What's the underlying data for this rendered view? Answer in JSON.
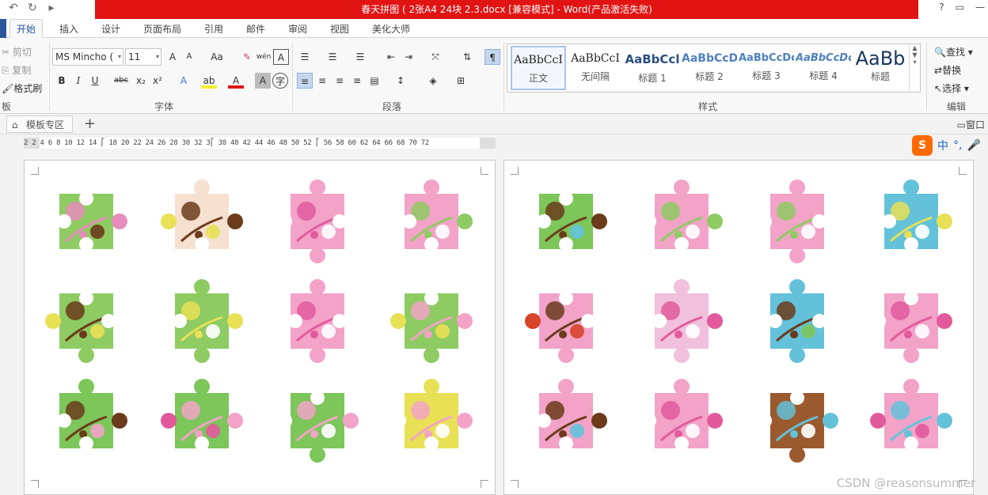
{
  "window": {
    "title": "春天拼图 ( 2张A4 24块 2.3.docx [兼容模式] - Word(产品激活失败)",
    "help": "?",
    "controls": [
      "?",
      "▭",
      "—"
    ]
  },
  "qat": [
    "↶",
    "↻",
    "▸"
  ],
  "tabs": [
    "开始",
    "插入",
    "设计",
    "页面布局",
    "引用",
    "邮件",
    "审阅",
    "视图",
    "美化大师"
  ],
  "active_tab": "开始",
  "clipboard": {
    "cut": "剪切",
    "copy": "复制",
    "format_painter": "格式刷",
    "group": "板"
  },
  "font": {
    "name": "MS Mincho (",
    "size": "11",
    "group": "字体",
    "bold": "B",
    "italic": "I",
    "underline": "U",
    "strike": "abc",
    "sub": "x₂",
    "sup": "x²",
    "grow": "A",
    "shrink": "A",
    "case": "Aa",
    "phonetic": "wén",
    "charborder": "A"
  },
  "paragraph": {
    "group": "段落"
  },
  "styles": {
    "group": "样式",
    "items": [
      {
        "preview": "AaBbCcI",
        "name": "正文"
      },
      {
        "preview": "AaBbCcI",
        "name": "无间隔"
      },
      {
        "preview": "AaBbCcl",
        "name": "标题 1"
      },
      {
        "preview": "AaBbCcD",
        "name": "标题 2"
      },
      {
        "preview": "AaBbCcDc",
        "name": "标题 3"
      },
      {
        "preview": "AaBbCcDc",
        "name": "标题 4"
      },
      {
        "preview": "AaBb",
        "name": "标题"
      }
    ]
  },
  "editing": {
    "find": "查找",
    "replace": "替换",
    "select": "选择",
    "group": "编辑"
  },
  "doctabs": {
    "tab": "模板专区",
    "add": "+",
    "right": "窗口"
  },
  "ruler": {
    "ticks": "2    2  4  6  8 10 12 14 ⎡ 18 20 22 24 26 28 30 32 3⎡ 38 40 42 44 46 48 50 52 ⎡ 56 58 60 62 64 66 68 70 72"
  },
  "ime": {
    "logo": "S",
    "lang": "中"
  },
  "watermark": "CSDN @reasonsummer",
  "colors": {
    "title_bar": "#e21313",
    "accent": "#2b579a",
    "pink": "#f2a3c7",
    "green": "#7cc65a",
    "yellow": "#e8e055",
    "brown": "#6b3b1b",
    "blue": "#63c2d9"
  },
  "pages": [
    {
      "name": "page-left",
      "pieces": [
        {
          "palette": [
            "#8ecb62",
            "#e68dbb",
            "#6b3b1b"
          ]
        },
        {
          "palette": [
            "#f6e0d0",
            "#6b3b1b",
            "#e8e055"
          ]
        },
        {
          "palette": [
            "#f2a3c7",
            "#e25a9c",
            "#ffffff"
          ]
        },
        {
          "palette": [
            "#f2a3c7",
            "#8ecb62",
            "#ffffff"
          ]
        },
        {
          "palette": [
            "#8ecb62",
            "#6b3b1b",
            "#e8e055"
          ]
        },
        {
          "palette": [
            "#8ecb62",
            "#e8e055",
            "#ffffff"
          ]
        },
        {
          "palette": [
            "#f2a3c7",
            "#e25a9c",
            "#ffffff"
          ]
        },
        {
          "palette": [
            "#8ecb62",
            "#f2a3c7",
            "#e8e055"
          ]
        },
        {
          "palette": [
            "#7cc65a",
            "#6b3b1b",
            "#f2a3c7"
          ]
        },
        {
          "palette": [
            "#7cc65a",
            "#f2a3c7",
            "#e25a9c"
          ]
        },
        {
          "palette": [
            "#7cc65a",
            "#f2a3c7",
            "#ffffff"
          ]
        },
        {
          "palette": [
            "#e8e055",
            "#f2a3c7",
            "#ffffff"
          ]
        }
      ]
    },
    {
      "name": "page-right",
      "pieces": [
        {
          "palette": [
            "#7cc65a",
            "#6b3b1b",
            "#63c2d9"
          ]
        },
        {
          "palette": [
            "#f2a3c7",
            "#8ecb62",
            "#ffffff"
          ]
        },
        {
          "palette": [
            "#f2a3c7",
            "#8ecb62",
            "#ffffff"
          ]
        },
        {
          "palette": [
            "#63c2d9",
            "#e8e055",
            "#ffffff"
          ]
        },
        {
          "palette": [
            "#f2a3c7",
            "#6b3b1b",
            "#d8442a"
          ]
        },
        {
          "palette": [
            "#f0c0dc",
            "#e25a9c",
            "#ffffff"
          ]
        },
        {
          "palette": [
            "#63c2d9",
            "#6b3b1b",
            "#7cc65a"
          ]
        },
        {
          "palette": [
            "#f2a3c7",
            "#e25a9c",
            "#ffffff"
          ]
        },
        {
          "palette": [
            "#f2a3c7",
            "#6b3b1b",
            "#63c2d9"
          ]
        },
        {
          "palette": [
            "#f2a3c7",
            "#e25a9c",
            "#ffffff"
          ]
        },
        {
          "palette": [
            "#9b5a2e",
            "#63c2d9",
            "#ffffff"
          ]
        },
        {
          "palette": [
            "#f2a3c7",
            "#63c2d9",
            "#e25a9c"
          ]
        }
      ]
    }
  ]
}
